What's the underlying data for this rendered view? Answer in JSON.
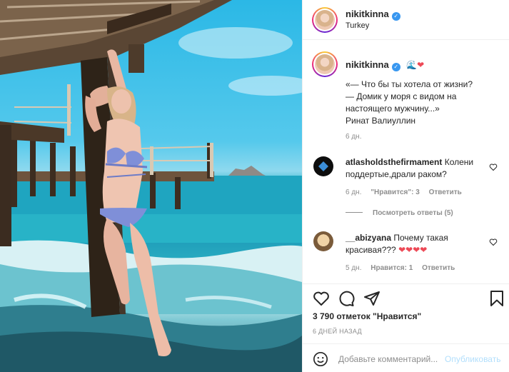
{
  "post": {
    "author": "nikitkinna",
    "location": "Turkey"
  },
  "caption": {
    "author": "nikitkinna",
    "emoji": "🌊❤",
    "text": "«— Что бы ты хотела от жизни?\n— Домик у моря с видом на\nнастоящего мужчину...»\nРинат Валиуллин",
    "time": "6 дн."
  },
  "comments": [
    {
      "author": "atlasholdsthefirmament",
      "text": "Колени поддертые,драли раком?",
      "time": "6 дн.",
      "likes": "\"Нравится\": 3",
      "reply": "Ответить",
      "view_replies": "Посмотреть ответы (5)"
    },
    {
      "author": "__abizyana",
      "text": "Почему такая красивая???",
      "hearts": "❤❤❤❤",
      "time": "5 дн.",
      "likes": "Нравится: 1",
      "reply": "Ответить"
    }
  ],
  "stats": {
    "likes": "3 790 отметок \"Нравится\"",
    "posted": "6 ДНЕЙ НАЗАД"
  },
  "add_comment": {
    "placeholder": "Добавьте комментарий...",
    "publish": "Опубликовать"
  },
  "icons": [
    "heart-icon",
    "comment-icon",
    "share-icon",
    "bookmark-icon",
    "emoji-icon",
    "verified-icon"
  ],
  "colors": {
    "verified": "#3897f0",
    "publish_disabled": "#b2dffc",
    "muted": "#8e8e8e",
    "like_heart": "#ed4956"
  }
}
